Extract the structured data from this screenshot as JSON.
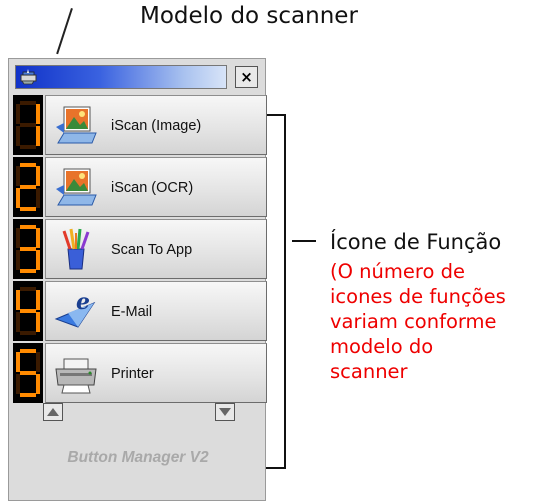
{
  "callouts": {
    "scanner_model": "Modelo do scanner",
    "function_icon": "Ícone de Função",
    "note_lines": [
      "(O número de",
      "icones de funções",
      "variam conforme",
      "modelo do",
      "scanner"
    ]
  },
  "window": {
    "close_label": "×",
    "footer_label": "Button Manager V2"
  },
  "buttons": [
    {
      "number": "1",
      "label": "iScan (Image)",
      "icon": "image-scan-icon"
    },
    {
      "number": "2",
      "label": "iScan (OCR)",
      "icon": "ocr-scan-icon"
    },
    {
      "number": "3",
      "label": "Scan To App",
      "icon": "paint-brushes-cup-icon"
    },
    {
      "number": "4",
      "label": "E-Mail",
      "icon": "email-e-icon"
    },
    {
      "number": "5",
      "label": "Printer",
      "icon": "printer-icon"
    }
  ],
  "colors": {
    "note_text": "#ee0000",
    "digit_segment": "#ff8a00",
    "title_gradient_start": "#1032c8"
  }
}
